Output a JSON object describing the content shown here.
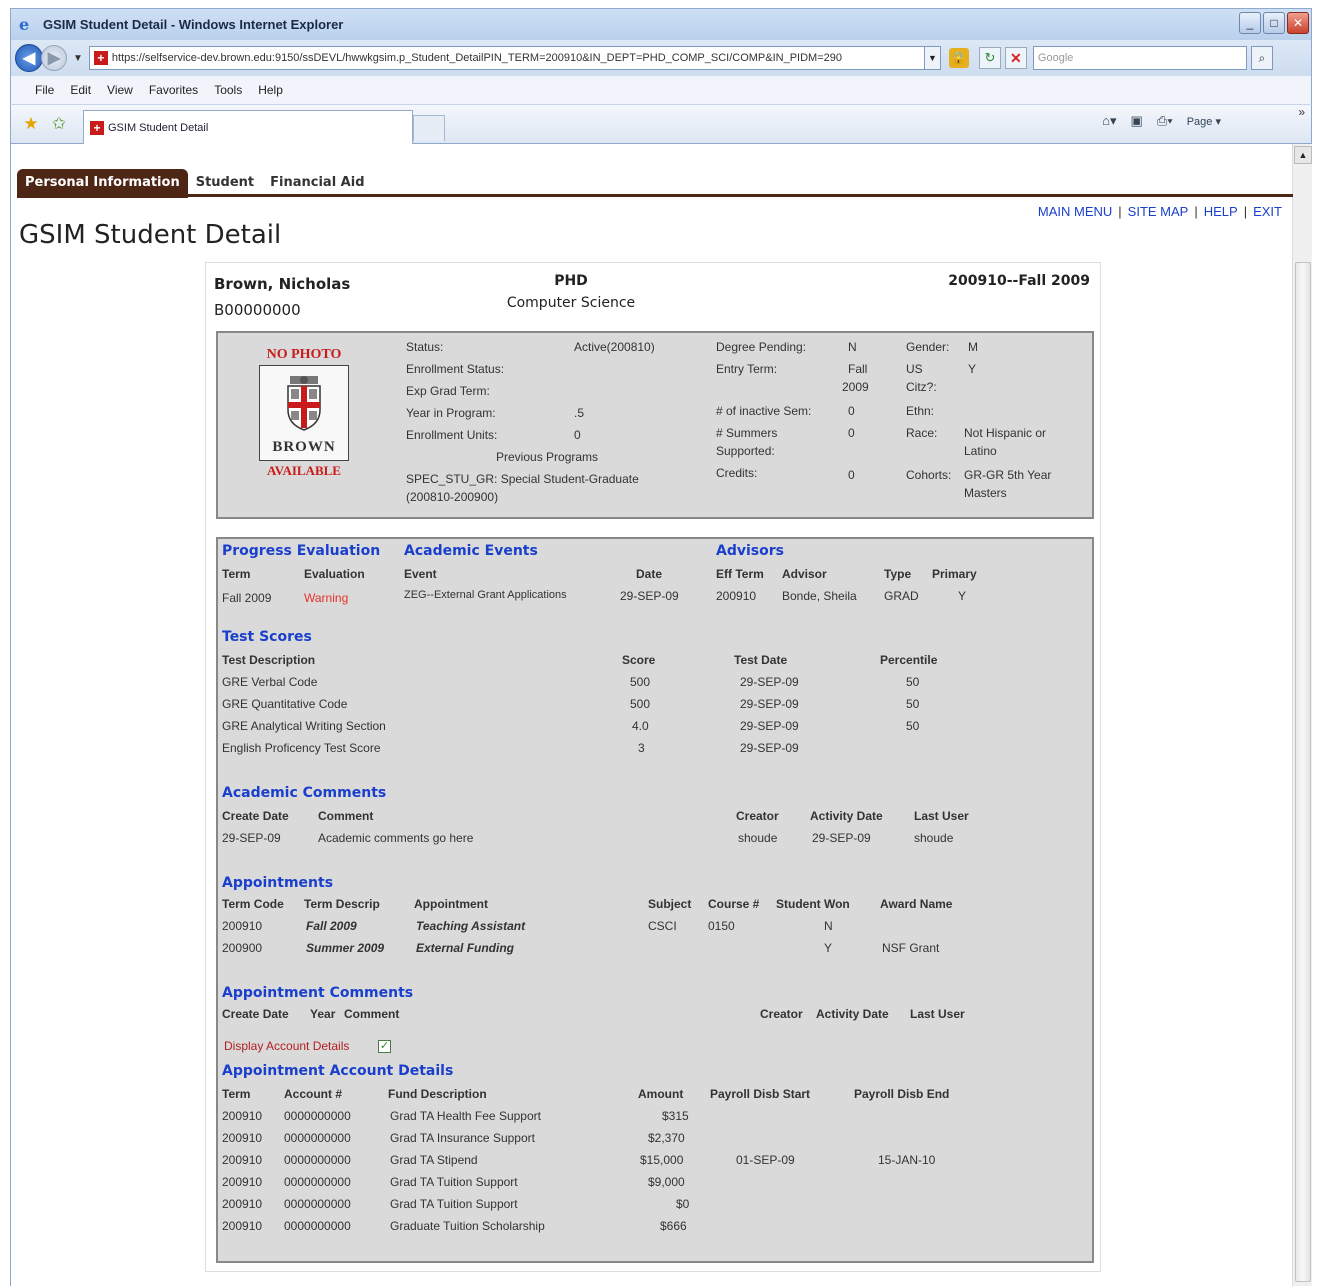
{
  "window": {
    "title": "GSIM Student Detail - Windows Internet Explorer",
    "url": "https://selfservice-dev.brown.edu:9150/ssDEVL/hwwkgsim.p_Student_DetailPIN_TERM=200910&IN_DEPT=PHD_COMP_SCI/COMP&IN_PIDM=290",
    "search_placeholder": "Google",
    "tab_title": "GSIM Student Detail",
    "menu": [
      "File",
      "Edit",
      "View",
      "Favorites",
      "Tools",
      "Help"
    ],
    "page_label": "Page"
  },
  "tabs": [
    "Personal Information",
    "Student",
    "Financial Aid"
  ],
  "links": [
    "MAIN MENU",
    "SITE MAP",
    "HELP",
    "EXIT"
  ],
  "page_title": "GSIM Student Detail",
  "student": {
    "name": "Brown, Nicholas",
    "id": "B00000000",
    "degree": "PHD",
    "major": "Computer Science",
    "term": "200910--Fall 2009"
  },
  "photo": {
    "top": "NO PHOTO",
    "logo": "BROWN",
    "bottom": "AVAILABLE"
  },
  "status": {
    "status_label": "Status:",
    "status_value": "Active(200810)",
    "enroll_status_label": "Enrollment Status:",
    "exp_grad_label": "Exp Grad Term:",
    "year_label": "Year in Program:",
    "year_value": ".5",
    "units_label": "Enrollment Units:",
    "units_value": "0",
    "prev_label": "Previous Programs",
    "prev_value1": "SPEC_STU_GR: Special Student-Graduate",
    "prev_value2": "(200810-200900)",
    "deg_pending_label": "Degree Pending:",
    "deg_pending_value": "N",
    "entry_label": "Entry Term:",
    "entry_value1": "Fall",
    "entry_value2": "2009",
    "inactive_label": "# of inactive Sem:",
    "inactive_value": "0",
    "summers_label1": "# Summers",
    "summers_label2": "Supported:",
    "summers_value": "0",
    "credits_label": "Credits:",
    "credits_value": "0",
    "gender_label": "Gender:",
    "gender_value": "M",
    "citz_label1": "US",
    "citz_label2": "Citz?:",
    "citz_value": "Y",
    "ethn_label": "Ethn:",
    "race_label": "Race:",
    "race_value1": "Not Hispanic or",
    "race_value2": "Latino",
    "cohorts_label": "Cohorts:",
    "cohorts_value1": "GR-GR 5th Year",
    "cohorts_value2": "Masters"
  },
  "progress": {
    "title": "Progress Evaluation",
    "headers": [
      "Term",
      "Evaluation"
    ],
    "rows": [
      [
        "Fall 2009",
        "Warning"
      ]
    ]
  },
  "academic_events": {
    "title": "Academic Events",
    "headers": [
      "Event",
      "Date"
    ],
    "rows": [
      [
        "ZEG--External Grant Applications",
        "29-SEP-09"
      ]
    ]
  },
  "advisors": {
    "title": "Advisors",
    "headers": [
      "Eff Term",
      "Advisor",
      "Type",
      "Primary"
    ],
    "rows": [
      [
        "200910",
        "Bonde, Sheila",
        "GRAD",
        "Y"
      ]
    ]
  },
  "test_scores": {
    "title": "Test Scores",
    "headers": [
      "Test Description",
      "Score",
      "Test Date",
      "Percentile"
    ],
    "rows": [
      [
        "GRE Verbal Code",
        "500",
        "29-SEP-09",
        "50"
      ],
      [
        "GRE Quantitative Code",
        "500",
        "29-SEP-09",
        "50"
      ],
      [
        "GRE Analytical Writing Section",
        "4.0",
        "29-SEP-09",
        "50"
      ],
      [
        "English Proficency Test Score",
        "3",
        "29-SEP-09",
        ""
      ]
    ]
  },
  "academic_comments": {
    "title": "Academic Comments",
    "headers": [
      "Create Date",
      "Comment",
      "Creator",
      "Activity Date",
      "Last User"
    ],
    "rows": [
      [
        "29-SEP-09",
        "Academic comments go here",
        "shoude",
        "29-SEP-09",
        "shoude"
      ]
    ]
  },
  "appointments": {
    "title": "Appointments",
    "headers": [
      "Term Code",
      "Term Descrip",
      "Appointment",
      "Subject",
      "Course #",
      "Student Won",
      "Award Name"
    ],
    "rows": [
      [
        "200910",
        "Fall 2009",
        "Teaching Assistant",
        "CSCI",
        "0150",
        "N",
        ""
      ],
      [
        "200900",
        "Summer 2009",
        "External Funding",
        "",
        "",
        "Y",
        "NSF Grant"
      ]
    ]
  },
  "appointment_comments": {
    "title": "Appointment Comments",
    "headers": [
      "Create Date",
      "Year",
      "Comment",
      "Creator",
      "Activity Date",
      "Last User"
    ]
  },
  "display_account": {
    "label": "Display Account Details",
    "checked": true
  },
  "account_details": {
    "title": "Appointment Account Details",
    "headers": [
      "Term",
      "Account #",
      "Fund Description",
      "Amount",
      "Payroll Disb Start",
      "Payroll Disb End"
    ],
    "rows": [
      [
        "200910",
        "0000000000",
        "Grad TA Health Fee Support",
        "$315",
        "",
        ""
      ],
      [
        "200910",
        "0000000000",
        "Grad TA Insurance Support",
        "$2,370",
        "",
        ""
      ],
      [
        "200910",
        "0000000000",
        "Grad TA Stipend",
        "$15,000",
        "01-SEP-09",
        "15-JAN-10"
      ],
      [
        "200910",
        "0000000000",
        "Grad TA Tuition Support",
        "$9,000",
        "",
        ""
      ],
      [
        "200910",
        "0000000000",
        "Grad TA Tuition Support",
        "$0",
        "",
        ""
      ],
      [
        "200910",
        "0000000000",
        "Graduate Tuition Scholarship",
        "$666",
        "",
        ""
      ]
    ]
  }
}
